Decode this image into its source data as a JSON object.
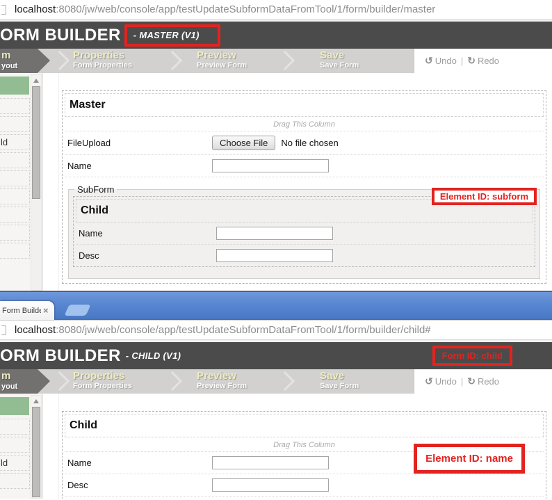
{
  "colors": {
    "annotation_red": "#e2231f",
    "header_gray": "#4b4b4b",
    "nav_gray": "#d2d1d0",
    "tab_title_yellow": "#eeedc2",
    "palette_green": "#92bd92",
    "chrome_blue": "#5585cf"
  },
  "icons": {
    "undo": "↺",
    "redo": "↻",
    "close": "×",
    "scroll_up": "triangle-up"
  },
  "browser": {
    "tab_title": "Form Builde",
    "close_label": "×"
  },
  "nav": {
    "active_line1": "m",
    "active_line2": "yout",
    "tabs": [
      {
        "title": "Properties",
        "subtitle": "Form Properties"
      },
      {
        "title": "Preview",
        "subtitle": "Preview Form"
      },
      {
        "title": "Save",
        "subtitle": "Save Form"
      }
    ],
    "undo": "Undo",
    "redo": "Redo",
    "divider": "|"
  },
  "palette": {
    "partial_label": "ld"
  },
  "master": {
    "url": {
      "host": "localhost",
      "rest": ":8080/jw/web/console/app/testUpdateSubformDataFromTool/1/form/builder/master"
    },
    "header": {
      "title": "FORM BUILDER",
      "subtitle": "- MASTER (V1)"
    },
    "form": {
      "title": "Master",
      "drag_hint": "Drag This Column",
      "file_field": {
        "label": "FileUpload",
        "button": "Choose File",
        "status": "No file chosen"
      },
      "name_field": {
        "label": "Name",
        "value": ""
      },
      "subform": {
        "legend": "SubForm",
        "annotation": "Element ID: subform",
        "title": "Child",
        "fields": [
          {
            "label": "Name",
            "value": ""
          },
          {
            "label": "Desc",
            "value": ""
          }
        ]
      }
    }
  },
  "child": {
    "url": {
      "host": "localhost",
      "rest": ":8080/jw/web/console/app/testUpdateSubformDataFromTool/1/form/builder/child#"
    },
    "header": {
      "title": "FORM BUILDER",
      "subtitle": "- CHILD (V1)",
      "annotation": "Form ID: child"
    },
    "form": {
      "title": "Child",
      "drag_hint": "Drag This Column",
      "fields": [
        {
          "label": "Name",
          "value": "",
          "annotation": "Element ID: name"
        },
        {
          "label": "Desc",
          "value": ""
        }
      ]
    }
  }
}
